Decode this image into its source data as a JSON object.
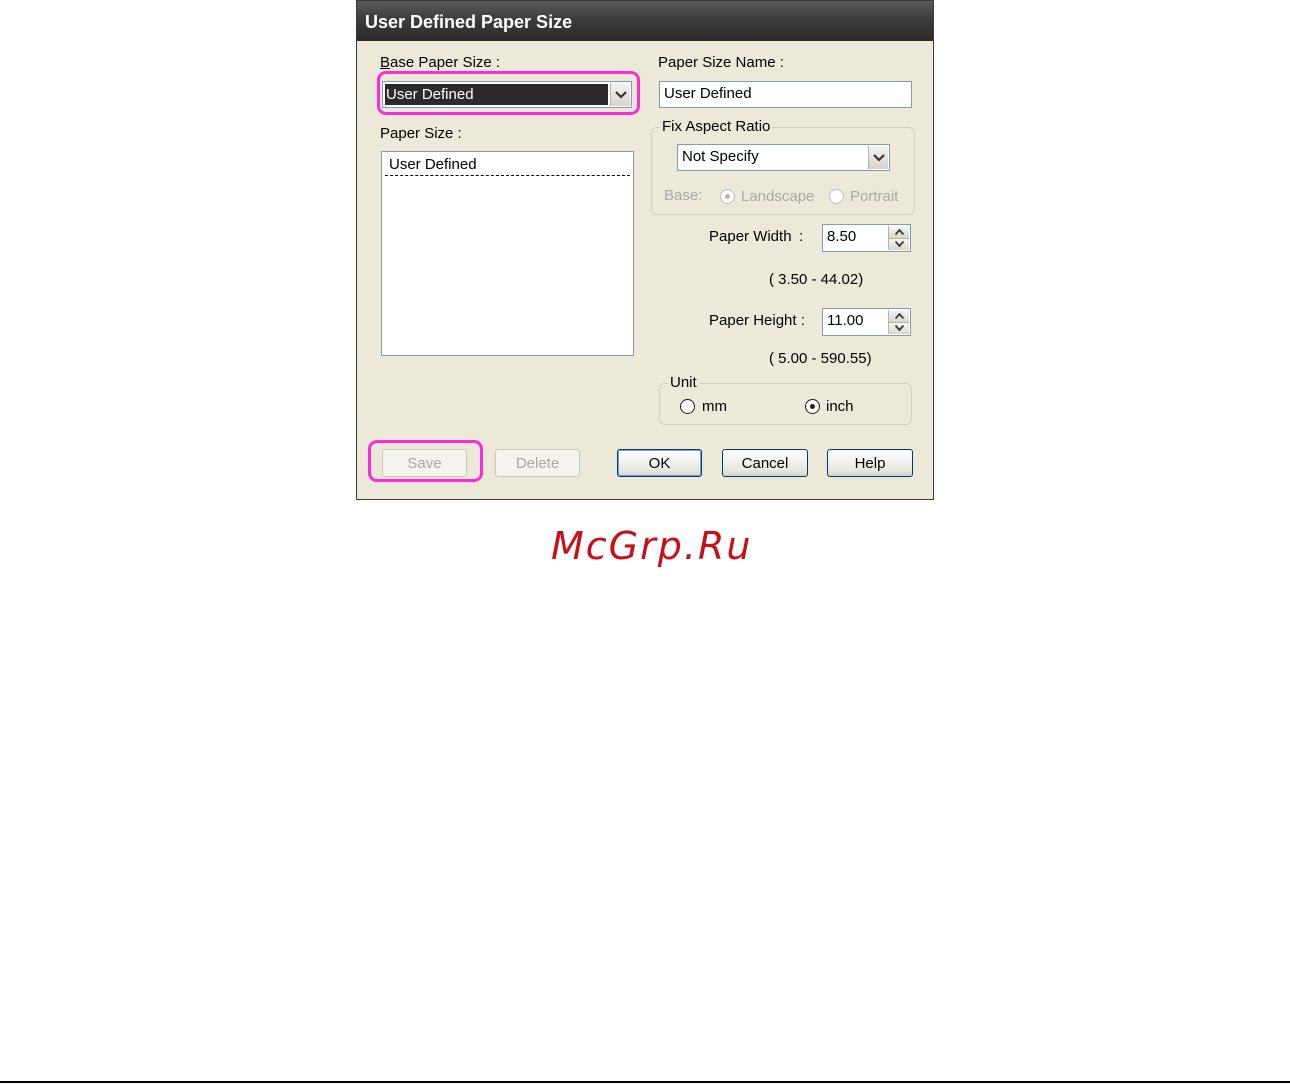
{
  "dialog": {
    "title": "User Defined Paper Size",
    "base_paper_size": {
      "label": "Base Paper Size :",
      "value": "User Defined"
    },
    "paper_size": {
      "label": "Paper Size :",
      "items": [
        "User Defined"
      ]
    },
    "paper_size_name": {
      "label": "Paper Size Name :",
      "value": "User Defined"
    },
    "fix_aspect_ratio": {
      "legend": "Fix Aspect Ratio",
      "value": "Not Specify",
      "base_label": "Base:",
      "landscape_label": "Landscape",
      "portrait_label": "Portrait",
      "selected": "Landscape"
    },
    "paper_width": {
      "label": "Paper Width",
      "colon": ":",
      "value": "8.50",
      "range": "( 3.50 - 44.02)"
    },
    "paper_height": {
      "label": "Paper Height :",
      "value": "11.00",
      "range": "( 5.00 - 590.55)"
    },
    "unit": {
      "legend": "Unit",
      "mm_label": "mm",
      "inch_label": "inch",
      "selected": "inch"
    },
    "buttons": {
      "save": "Save",
      "delete": "Delete",
      "ok": "OK",
      "cancel": "Cancel",
      "help": "Help"
    }
  },
  "watermark": "McGrp.Ru",
  "colors": {
    "highlight": "#ff2bd9",
    "watermark": "#c8101a",
    "dialog_face": "#ece9d8"
  },
  "icons": {
    "combo_arrow": "chevron-down-icon",
    "spin_up": "caret-up-icon",
    "spin_down": "caret-down-icon"
  }
}
